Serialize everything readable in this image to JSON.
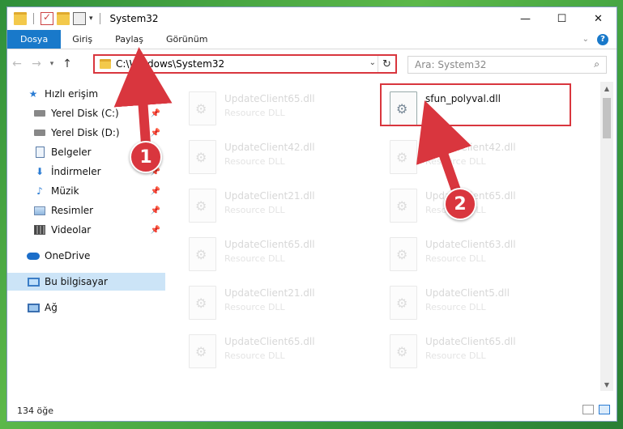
{
  "window": {
    "title": "System32",
    "controls": {
      "minimize": "—",
      "maximize": "☐",
      "close": "✕"
    }
  },
  "ribbon": {
    "tabs": [
      "Dosya",
      "Giriş",
      "Paylaş",
      "Görünüm"
    ],
    "help": "?"
  },
  "address": {
    "path": "C:\\Windows\\System32",
    "search_placeholder": "Ara: System32"
  },
  "sidebar": {
    "quick_access": "Hızlı erişim",
    "items": [
      {
        "label": "Yerel Disk (C:)",
        "icon": "drive-icon",
        "pinned": true
      },
      {
        "label": "Yerel Disk (D:)",
        "icon": "drive-icon",
        "pinned": true
      },
      {
        "label": "Belgeler",
        "icon": "documents-icon",
        "pinned": true
      },
      {
        "label": "İndirmeler",
        "icon": "downloads-icon",
        "pinned": true
      },
      {
        "label": "Müzik",
        "icon": "music-icon",
        "pinned": true
      },
      {
        "label": "Resimler",
        "icon": "pictures-icon",
        "pinned": true
      },
      {
        "label": "Videolar",
        "icon": "videos-icon",
        "pinned": true
      }
    ],
    "onedrive": "OneDrive",
    "this_pc": "Bu bilgisayar",
    "network": "Ağ"
  },
  "files": {
    "left": [
      {
        "name": "UpdateClient65.dll",
        "type": "Resource DLL"
      },
      {
        "name": "UpdateClient42.dll",
        "type": "Resource DLL"
      },
      {
        "name": "UpdateClient21.dll",
        "type": "Resource DLL"
      },
      {
        "name": "UpdateClient65.dll",
        "type": "Resource DLL"
      },
      {
        "name": "UpdateClient21.dll",
        "type": "Resource DLL"
      },
      {
        "name": "UpdateClient65.dll",
        "type": "Resource DLL"
      }
    ],
    "right": [
      {
        "name": "sfun_polyval.dll",
        "type": "",
        "target": true
      },
      {
        "name": "UpdateClient42.dll",
        "type": "Resource DLL"
      },
      {
        "name": "UpdateClient65.dll",
        "type": "Resource DLL"
      },
      {
        "name": "UpdateClient63.dll",
        "type": "Resource DLL"
      },
      {
        "name": "UpdateClient5.dll",
        "type": "Resource DLL"
      },
      {
        "name": "UpdateClient65.dll",
        "type": "Resource DLL"
      }
    ]
  },
  "status": {
    "count": "134 öğe"
  },
  "callouts": {
    "one": "1",
    "two": "2"
  },
  "colors": {
    "accent": "#1979ca",
    "annotation": "#d9363e"
  }
}
